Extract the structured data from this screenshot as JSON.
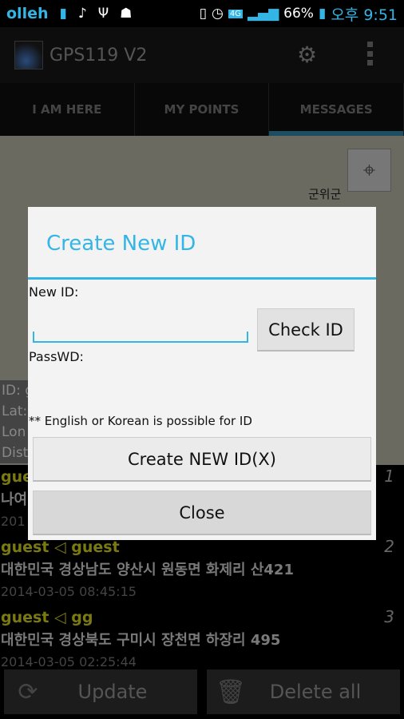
{
  "status_bar": {
    "carrier": "olleh",
    "network": "4G",
    "battery": "66%",
    "time": "오후 9:51",
    "icons": [
      "usb-battery-icon",
      "music-note-icon",
      "usb-icon",
      "android-debug-icon",
      "vibrate-icon",
      "alarm-icon",
      "network-4g-icon",
      "signal-icon",
      "battery-charging-icon"
    ]
  },
  "action_bar": {
    "title": "GPS119 V2",
    "icons": [
      "app-logo",
      "gear-icon",
      "overflow-menu-icon"
    ]
  },
  "tabs": [
    {
      "label": "I AM HERE"
    },
    {
      "label": "MY POINTS"
    },
    {
      "label": "MESSAGES",
      "active": true
    }
  ],
  "map": {
    "city_label": "군위군",
    "info": [
      "ID: g",
      "Lat:",
      "Lon",
      "Dist"
    ]
  },
  "messages": [
    {
      "from": "gue",
      "address": "나여",
      "time": "201",
      "num": "1"
    },
    {
      "from": "guest ◁ guest",
      "address": "대한민국 경상남도 양산시 원동면 화제리 산421",
      "time": "2014-03-05 08:45:15",
      "num": "2"
    },
    {
      "from": "guest ◁ gg",
      "address": "대한민국 경상북도 구미시 장천면 하장리 495",
      "time": "2014-03-05 02:25:44",
      "num": "3"
    }
  ],
  "bottom": {
    "update": "Update",
    "delete_all": "Delete all"
  },
  "dialog": {
    "title": "Create New ID",
    "new_id_label": "New ID:",
    "new_id_value": "",
    "check_id": "Check ID",
    "passwd_label": "PassWD:",
    "passwd_value": "",
    "note": "** English or Korean is possible for ID",
    "create": "Create NEW ID(X)",
    "close": "Close"
  },
  "colors": {
    "accent": "#33b5e5",
    "sender": "#7a7a10"
  }
}
